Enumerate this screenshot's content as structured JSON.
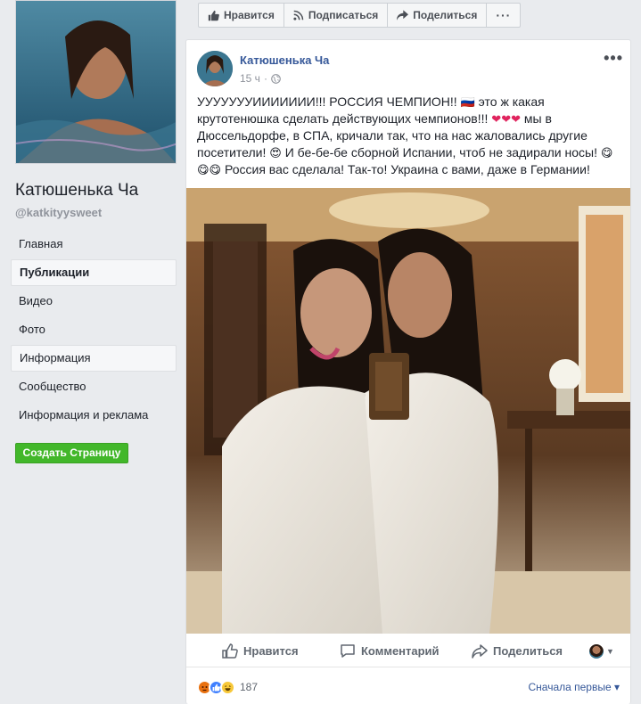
{
  "page": {
    "name": "Катюшенька Ча",
    "handle": "@katkityysweet"
  },
  "nav": {
    "items": [
      {
        "label": "Главная"
      },
      {
        "label": "Публикации"
      },
      {
        "label": "Видео"
      },
      {
        "label": "Фото"
      },
      {
        "label": "Информация"
      },
      {
        "label": "Сообщество"
      },
      {
        "label": "Информация и реклама"
      }
    ],
    "active_index": 1,
    "create_page_label": "Создать Страницу"
  },
  "top_bar": {
    "like_label": "Нравится",
    "subscribe_label": "Подписаться",
    "share_label": "Поделиться",
    "more_label": "···"
  },
  "post": {
    "author": "Катюшенька Ча",
    "time": "15 ч",
    "more_label": "•••",
    "text_parts": {
      "p1": "УУУУУУУИИИИИИИ!!! РОССИЯ ЧЕМПИОН!! ",
      "p2": " это ж какая крутотенюшка сделать действующих чемпионов!!! ",
      "p3": " мы в Дюссельдорфе, в СПА, кричали так, что на нас жаловались другие посетители! ",
      "p4": " И бе-бе-бе сборной Испании, чтоб не задирали носы! ",
      "p5": " Россия вас сделала! Так-то! Украина с вами, даже в Германии!"
    },
    "emoji": {
      "flag": "🇷🇺",
      "hearts": "❤❤❤",
      "heart_eyes": "😍",
      "yum": "😋",
      "yum2": "😋😋"
    },
    "actions": {
      "like_label": "Нравится",
      "comment_label": "Комментарий",
      "share_label": "Поделиться"
    },
    "reactions": {
      "count": "187",
      "sort_label": "Сначала первые ▾"
    }
  },
  "colors": {
    "background": "#e9ebee",
    "link": "#365899",
    "create_button": "#42b72a"
  }
}
